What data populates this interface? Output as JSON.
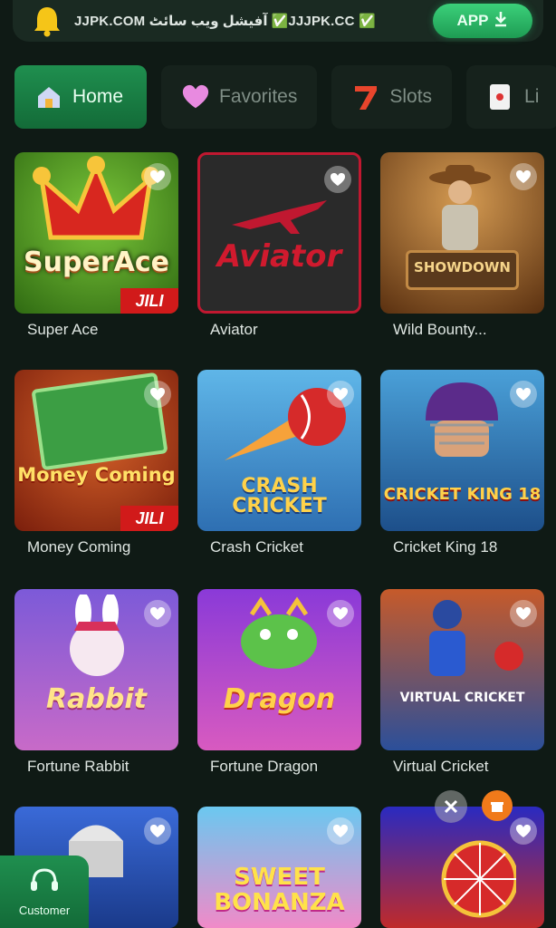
{
  "banner": {
    "text": "JJPK.COM آفیشل ویب سائٹ ✅JJJPK.CC ✅",
    "app_label": "APP"
  },
  "tabs": [
    {
      "label": "Home",
      "icon": "home-icon",
      "active": true
    },
    {
      "label": "Favorites",
      "icon": "heart-icon",
      "active": false
    },
    {
      "label": "Slots",
      "icon": "seven-icon",
      "active": false
    },
    {
      "label": "Li",
      "icon": "cards-icon",
      "active": false
    }
  ],
  "games": [
    {
      "title": "Super Ace",
      "art": "SuperAce",
      "badge": "JILI"
    },
    {
      "title": "Aviator",
      "art": "Aviator",
      "badge": ""
    },
    {
      "title": "Wild Bounty...",
      "art": "SHOWDOWN",
      "badge": ""
    },
    {
      "title": "Money Coming",
      "art": "Money Coming",
      "badge": "JILI"
    },
    {
      "title": "Crash Cricket",
      "art": "CRASH CRICKET",
      "badge": ""
    },
    {
      "title": "Cricket King 18",
      "art": "CRICKET KING 18",
      "badge": ""
    },
    {
      "title": "Fortune Rabbit",
      "art": "Rabbit",
      "badge": ""
    },
    {
      "title": "Fortune Dragon",
      "art": "Dragon",
      "badge": ""
    },
    {
      "title": "Virtual Cricket",
      "art": "VIRTUAL CRICKET",
      "badge": ""
    },
    {
      "title": "",
      "art": "",
      "badge": ""
    },
    {
      "title": "",
      "art": "SWEET BONANZA",
      "badge": ""
    },
    {
      "title": "",
      "art": "",
      "badge": ""
    }
  ],
  "customer_service": {
    "label": "Customer"
  },
  "colors": {
    "accent": "#1f8f4f",
    "background": "#0f1a15",
    "jili_red": "#d11a1a"
  }
}
